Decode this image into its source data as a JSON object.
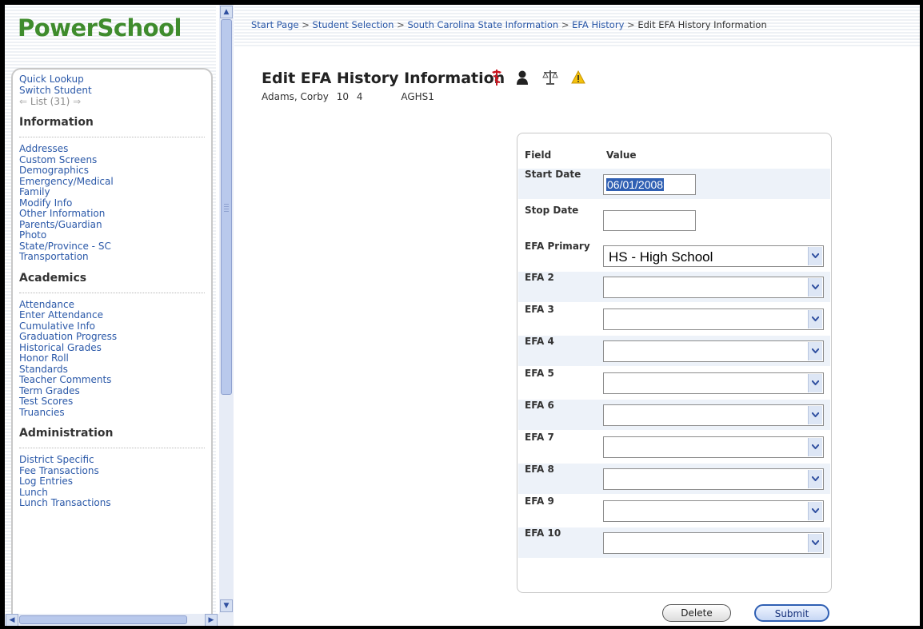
{
  "app": {
    "logo": "PowerSchool"
  },
  "sidebar": {
    "quick": [
      {
        "label": "Quick Lookup"
      },
      {
        "label": "Switch Student"
      }
    ],
    "list_label": "List (31)",
    "sections": [
      {
        "title": "Information",
        "items": [
          "Addresses",
          "Custom Screens",
          "Demographics",
          "Emergency/Medical",
          "Family",
          "Modify Info",
          "Other Information",
          "Parents/Guardian",
          "Photo",
          "State/Province - SC",
          "Transportation"
        ]
      },
      {
        "title": "Academics",
        "items": [
          "Attendance",
          "Enter Attendance",
          "Cumulative Info",
          "Graduation Progress",
          "Historical Grades",
          "Honor Roll",
          "Standards",
          "Teacher Comments",
          "Term Grades",
          "Test Scores",
          "Truancies"
        ]
      },
      {
        "title": "Administration",
        "items": [
          "District Specific",
          "Fee Transactions",
          "Log Entries",
          "Lunch",
          "Lunch Transactions"
        ]
      }
    ]
  },
  "breadcrumb": {
    "links": [
      "Start Page",
      "Student Selection",
      "South Carolina State Information",
      "EFA History"
    ],
    "current": "Edit EFA History Information",
    "separator": ">"
  },
  "page": {
    "title": "Edit EFA History Information",
    "icons": [
      "medical-alert-icon",
      "guardian-icon",
      "legal-icon",
      "warning-icon"
    ],
    "student": {
      "name": "Adams, Corby",
      "grade": "10",
      "track": "4",
      "school": "AGHS1"
    }
  },
  "form": {
    "header_field": "Field",
    "header_value": "Value",
    "start_date": {
      "label": "Start Date",
      "value": "06/01/2008"
    },
    "stop_date": {
      "label": "Stop Date",
      "value": ""
    },
    "efa": [
      {
        "label": "EFA Primary",
        "value": "HS - High School"
      },
      {
        "label": "EFA 2",
        "value": ""
      },
      {
        "label": "EFA 3",
        "value": ""
      },
      {
        "label": "EFA 4",
        "value": ""
      },
      {
        "label": "EFA 5",
        "value": ""
      },
      {
        "label": "EFA 6",
        "value": ""
      },
      {
        "label": "EFA 7",
        "value": ""
      },
      {
        "label": "EFA 8",
        "value": ""
      },
      {
        "label": "EFA 9",
        "value": ""
      },
      {
        "label": "EFA 10",
        "value": ""
      }
    ]
  },
  "buttons": {
    "delete": "Delete",
    "submit": "Submit"
  },
  "colors": {
    "logo": "#3f8c2d",
    "link": "#2a58a8",
    "accent": "#2f5fb3"
  }
}
